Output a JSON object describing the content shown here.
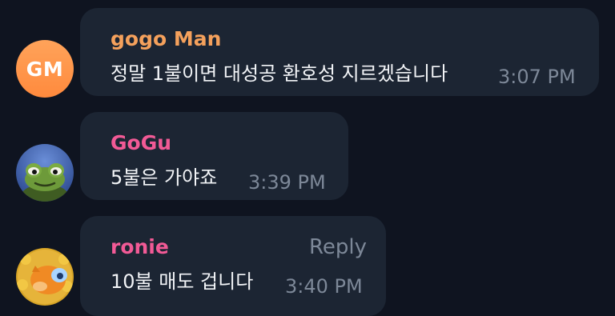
{
  "messages": [
    {
      "avatar": {
        "type": "initials",
        "initials": "GM",
        "color": "#ff9447"
      },
      "sender": "gogo Man",
      "sender_color": "#f5a15c",
      "text": "정말 1불이면 대성공 환호성 지르겠습니다",
      "time": "3:07 PM"
    },
    {
      "avatar": {
        "type": "image",
        "icon": "frog-avatar-icon"
      },
      "sender": "GoGu",
      "sender_color": "#f25a96",
      "text": "5불은 가야죠",
      "time": "3:39 PM"
    },
    {
      "avatar": {
        "type": "image",
        "icon": "doge-sunflower-avatar-icon"
      },
      "sender": "ronie",
      "sender_color": "#f25a96",
      "text": "10불 매도 겁니다",
      "time": "3:40 PM",
      "action": "Reply"
    }
  ],
  "colors": {
    "background": "#0f1420",
    "bubble": "#1c2533",
    "message_text": "#f2f4f7",
    "timestamp": "#7d8898"
  }
}
